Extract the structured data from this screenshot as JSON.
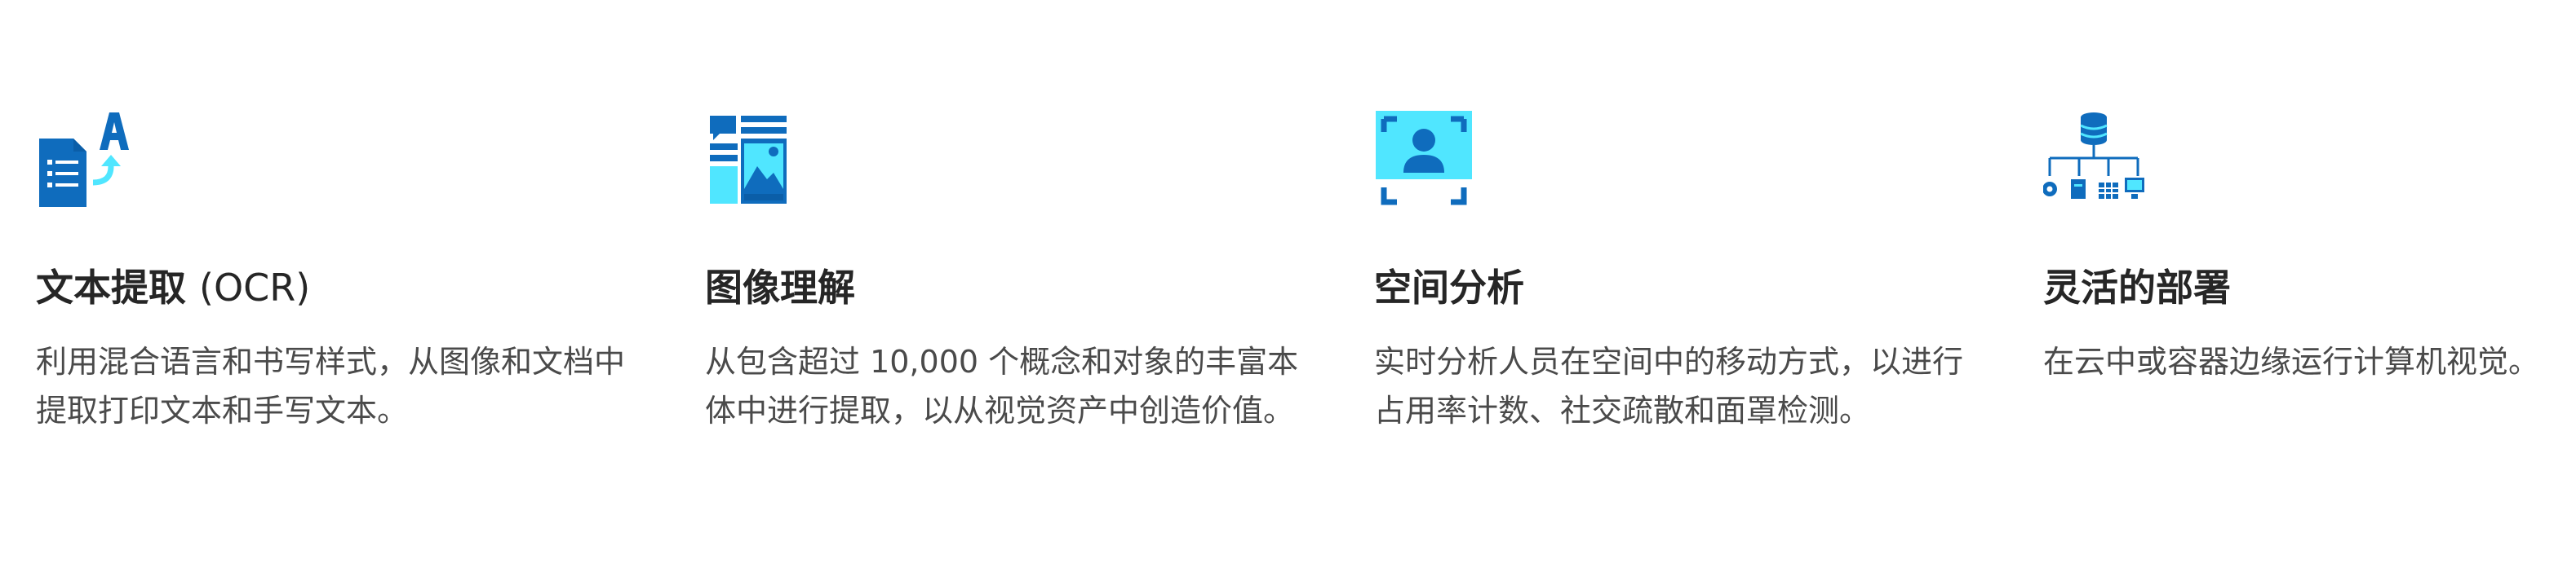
{
  "colors": {
    "primary_blue": "#0F6CBD",
    "dark_blue": "#0B5EA8",
    "light_cyan": "#50E6FF",
    "title_text": "#262626",
    "body_text": "#4A4A4A"
  },
  "features": [
    {
      "icon": "ocr-document-icon",
      "title": "文本提取",
      "title_suffix": "(OCR)",
      "description": "利用混合语言和书写样式，从图像和文档中提取打印文本和手写文本。"
    },
    {
      "icon": "image-layout-icon",
      "title": "图像理解",
      "title_suffix": "",
      "description": "从包含超过 10,000 个概念和对象的丰富本体中进行提取，以从视觉资产中创造价值。"
    },
    {
      "icon": "person-frame-icon",
      "title": "空间分析",
      "title_suffix": "",
      "description": "实时分析人员在空间中的移动方式，以进行占用率计数、社交疏散和面罩检测。"
    },
    {
      "icon": "deployment-tree-icon",
      "title": "灵活的部署",
      "title_suffix": "",
      "description": "在云中或容器边缘运行计算机视觉。"
    }
  ]
}
